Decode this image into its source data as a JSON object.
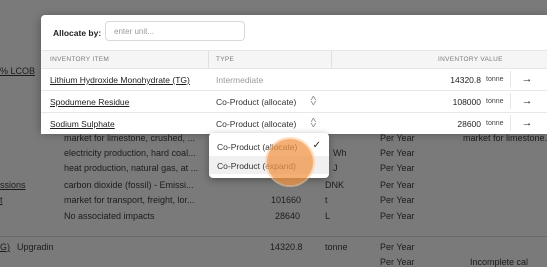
{
  "modal": {
    "allocate_label": "Allocate by:",
    "allocate_placeholder": "enter unit...",
    "columns": {
      "item": "INVENTORY ITEM",
      "type": "TYPE",
      "value": "INVENTORY VALUE"
    },
    "rows": [
      {
        "item": "Lithium Hydroxide Monohydrate (TG)",
        "type": "Intermediate",
        "value": "14320.8",
        "unit": "tonne",
        "arrow": "→"
      },
      {
        "item": "Spodumene Residue",
        "type": "Co-Product (allocate)",
        "value": "108000",
        "unit": "tonne",
        "arrow": "→"
      },
      {
        "item": "Sodium Sulphate",
        "type": "Co-Product (allocate)",
        "value": "28600",
        "unit": "tonne",
        "arrow": "→"
      }
    ]
  },
  "dropdown": {
    "options": [
      {
        "label": "Co-Product (allocate)",
        "checked": true
      },
      {
        "label": "Co-Product (expand)",
        "checked": false
      }
    ],
    "check_glyph": "✓"
  },
  "background": {
    "left_fragments": [
      "% LCOB",
      "ssions",
      "t",
      "G)",
      "Upgradin"
    ],
    "rows": [
      {
        "desc": "market for limestone, crushed, ...",
        "unit": "",
        "period": "Per Year",
        "note": "market for limestone..."
      },
      {
        "desc": "electricity production, hard coal...",
        "unit": "Wh",
        "period": "Per Year",
        "note": ""
      },
      {
        "desc": "heat production, natural gas, at ...",
        "unit": "J",
        "period": "Per Year",
        "note": ""
      },
      {
        "desc": "carbon dioxide (fossil) - Emissi...",
        "qty": "",
        "unit": "DNK",
        "period": "Per Year",
        "note": ""
      },
      {
        "desc": "market for transport, freight, lor...",
        "qty": "101660",
        "unit": "t",
        "period": "Per Year",
        "note": ""
      },
      {
        "desc": "No associated impacts",
        "qty": "28640",
        "unit": "L",
        "period": "Per Year",
        "note": ""
      },
      {
        "desc": "",
        "qty": "14320.8",
        "unit": "tonne",
        "period": "Per Year",
        "note": ""
      },
      {
        "desc": "",
        "qty": "",
        "unit": "",
        "period": "Per Year",
        "note": "Incomplete cal"
      }
    ]
  },
  "colors": {
    "overlay": "#7a7a7a",
    "cursor": "#f0964a"
  }
}
